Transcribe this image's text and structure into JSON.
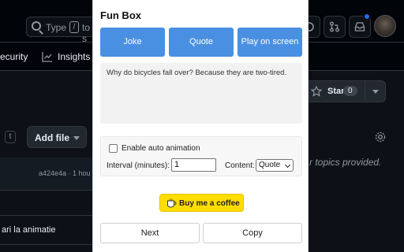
{
  "background": {
    "search": {
      "placeholder_start": "Type",
      "slash_key": "/",
      "placeholder_end": "to s"
    },
    "tabs": {
      "security": "ecurity",
      "insights": "Insights"
    },
    "star": {
      "label": "Star",
      "count": "0"
    },
    "kbd_hint": "t",
    "add_file": "Add file",
    "topics": "r topics provided.",
    "commit": "a424e4a · 1 hou",
    "file_entry": "ari la animatie",
    "colors": {
      "page_bg": "#0d1117",
      "notification_dot": "#1f6feb"
    }
  },
  "popup": {
    "title": "Fun Box",
    "buttons": {
      "joke": "Joke",
      "quote": "Quote",
      "play": "Play on screen"
    },
    "output_text": "Why do bicycles fall over? Because they are two-tired.",
    "settings": {
      "auto_animation_label": "Enable auto animation",
      "auto_animation_checked": false,
      "interval_label": "Interval (minutes):",
      "interval_value": "1",
      "content_label": "Content:",
      "content_selected": "Quote"
    },
    "coffee_label": "Buy me a coffee",
    "next_label": "Next",
    "copy_label": "Copy",
    "colors": {
      "primary_button": "#4a90e2",
      "coffee_button": "#ffdd00"
    }
  }
}
